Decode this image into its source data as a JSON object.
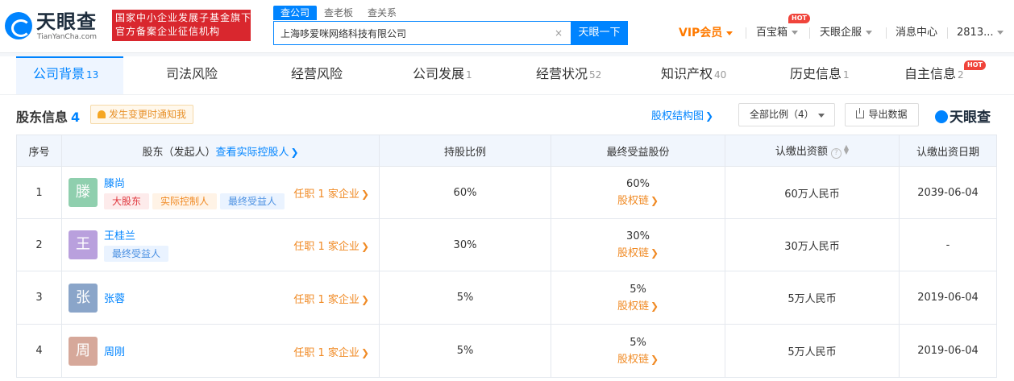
{
  "header": {
    "logo_text": "天眼查",
    "logo_sub": "TianYanCha.com",
    "banner_line1": "国家中小企业发展子基金旗下",
    "banner_line2": "官方备案企业征信机构",
    "search_tabs": [
      "查公司",
      "查老板",
      "查关系"
    ],
    "search_value": "上海哆爱咪网络科技有限公司",
    "clear_icon": "×",
    "search_button": "天眼一下",
    "nav": {
      "vip": "VIP会员",
      "treasure": "百宝箱",
      "hot": "HOT",
      "enterprise": "天眼企服",
      "messages": "消息中心",
      "user": "2813..."
    }
  },
  "tabs": [
    {
      "label": "公司背景",
      "count": "13"
    },
    {
      "label": "司法风险",
      "count": ""
    },
    {
      "label": "经营风险",
      "count": ""
    },
    {
      "label": "公司发展",
      "count": "1"
    },
    {
      "label": "经营状况",
      "count": "52"
    },
    {
      "label": "知识产权",
      "count": "40"
    },
    {
      "label": "历史信息",
      "count": "1"
    },
    {
      "label": "自主信息",
      "count": "2"
    }
  ],
  "tab_hot": "HOT",
  "section": {
    "title": "股东信息",
    "count": "4",
    "notify": "发生变更时通知我",
    "equity_link": "股权结构图",
    "ratio_select": "全部比例（4）",
    "export": "导出数据",
    "brand": "天眼查"
  },
  "table": {
    "headers": {
      "index": "序号",
      "holder": "股东（发起人）",
      "holder_link": "查看实际控股人",
      "ratio": "持股比例",
      "benefit": "最终受益股份",
      "capital": "认缴出资额",
      "info": "?",
      "date": "认缴出资日期"
    },
    "rows": [
      {
        "index": "1",
        "avatar": "滕",
        "avatar_color": "#8fcfae",
        "name": "滕尚",
        "tags": [
          {
            "text": "大股东",
            "kind": "red"
          },
          {
            "text": "实际控制人",
            "kind": "orange"
          },
          {
            "text": "最终受益人",
            "kind": "blue"
          }
        ],
        "job": "任职 1 家企业",
        "ratio": "60%",
        "benefit": "60%",
        "chain": "股权链",
        "capital": "60万人民币",
        "date": "2039-06-04"
      },
      {
        "index": "2",
        "avatar": "王",
        "avatar_color": "#b9a0dd",
        "name": "王桂兰",
        "tags": [
          {
            "text": "最终受益人",
            "kind": "blue"
          }
        ],
        "job": "任职 1 家企业",
        "ratio": "30%",
        "benefit": "30%",
        "chain": "股权链",
        "capital": "30万人民币",
        "date": "-"
      },
      {
        "index": "3",
        "avatar": "张",
        "avatar_color": "#8aa5c9",
        "name": "张蓉",
        "tags": [],
        "job": "任职 1 家企业",
        "ratio": "5%",
        "benefit": "5%",
        "chain": "股权链",
        "capital": "5万人民币",
        "date": "2019-06-04"
      },
      {
        "index": "4",
        "avatar": "周",
        "avatar_color": "#d6a89a",
        "name": "周刚",
        "tags": [],
        "job": "任职 1 家企业",
        "ratio": "5%",
        "benefit": "5%",
        "chain": "股权链",
        "capital": "5万人民币",
        "date": "2019-06-04"
      }
    ]
  }
}
